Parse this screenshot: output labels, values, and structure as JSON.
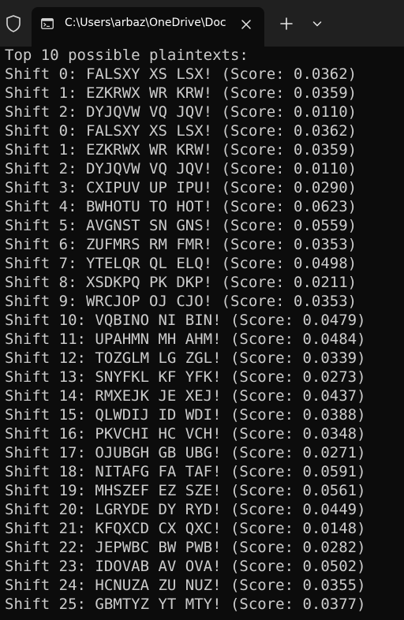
{
  "tab": {
    "title": "C:\\Users\\arbaz\\OneDrive\\Doc",
    "icon": "terminal-icon"
  },
  "titlebar": {
    "new_tab_label": "+",
    "icons": [
      "shield-icon",
      "close-icon",
      "plus-icon",
      "chevron-down-icon"
    ]
  },
  "terminal": {
    "header": "Top 10 possible plaintexts:",
    "lines": [
      "Shift 0: FALSXY XS LSX! (Score: 0.0362)",
      "Shift 1: EZKRWX WR KRW! (Score: 0.0359)",
      "Shift 2: DYJQVW VQ JQV! (Score: 0.0110)",
      "Shift 0: FALSXY XS LSX! (Score: 0.0362)",
      "Shift 1: EZKRWX WR KRW! (Score: 0.0359)",
      "Shift 2: DYJQVW VQ JQV! (Score: 0.0110)",
      "Shift 3: CXIPUV UP IPU! (Score: 0.0290)",
      "Shift 4: BWHOTU TO HOT! (Score: 0.0623)",
      "Shift 5: AVGNST SN GNS! (Score: 0.0559)",
      "Shift 6: ZUFMRS RM FMR! (Score: 0.0353)",
      "Shift 7: YTELQR QL ELQ! (Score: 0.0498)",
      "Shift 8: XSDKPQ PK DKP! (Score: 0.0211)",
      "Shift 9: WRCJOP OJ CJO! (Score: 0.0353)",
      "Shift 10: VQBINO NI BIN! (Score: 0.0479)",
      "Shift 11: UPAHMN MH AHM! (Score: 0.0484)",
      "Shift 12: TOZGLM LG ZGL! (Score: 0.0339)",
      "Shift 13: SNYFKL KF YFK! (Score: 0.0273)",
      "Shift 14: RMXEJK JE XEJ! (Score: 0.0437)",
      "Shift 15: QLWDIJ ID WDI! (Score: 0.0388)",
      "Shift 16: PKVCHI HC VCH! (Score: 0.0348)",
      "Shift 17: OJUBGH GB UBG! (Score: 0.0271)",
      "Shift 18: NITAFG FA TAF! (Score: 0.0591)",
      "Shift 19: MHSZEF EZ SZE! (Score: 0.0561)",
      "Shift 20: LGRYDE DY RYD! (Score: 0.0449)",
      "Shift 21: KFQXCD CX QXC! (Score: 0.0148)",
      "Shift 22: JEPWBC BW PWB! (Score: 0.0282)",
      "Shift 23: IDOVAB AV OVA! (Score: 0.0502)",
      "Shift 24: HCNUZA ZU NUZ! (Score: 0.0355)",
      "Shift 25: GBMTYZ YT MTY! (Score: 0.0377)"
    ]
  },
  "colors": {
    "titlebar_bg": "#202020",
    "terminal_bg": "#0c0c0c",
    "text": "#cccccc",
    "tab_text": "#ffffff"
  }
}
